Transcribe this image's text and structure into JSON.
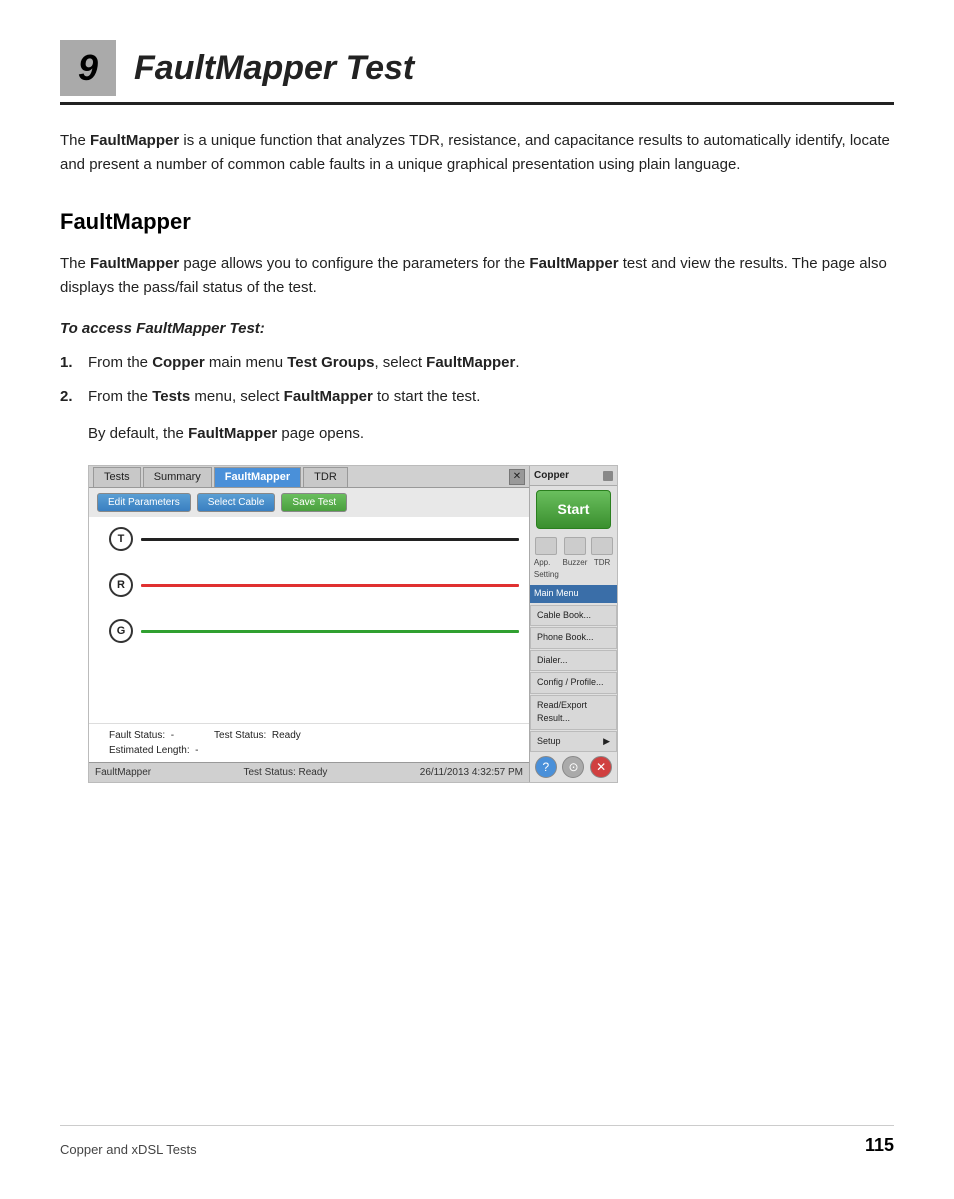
{
  "chapter": {
    "number": "9",
    "title": "FaultMapper Test"
  },
  "intro": {
    "text_prefix": "The ",
    "bold1": "FaultMapper",
    "text_middle": " is a unique function that analyzes TDR, resistance, and capacitance results to automatically identify, locate and present a number of common cable faults in a unique graphical presentation using plain language."
  },
  "section": {
    "title": "FaultMapper",
    "para_prefix": "The ",
    "para_bold1": "FaultMapper",
    "para_text1": " page allows you to configure the parameters for the ",
    "para_bold2": "FaultMapper",
    "para_text2": " test and view the results. The page also displays the pass/fail status of the test."
  },
  "access": {
    "heading": "To access FaultMapper Test:",
    "steps": [
      {
        "num": "1.",
        "text_prefix": "From the ",
        "bold1": "Copper",
        "text_middle": " main menu ",
        "bold2": "Test Groups",
        "text_end": ", select ",
        "bold3": "FaultMapper",
        "text_final": "."
      },
      {
        "num": "2.",
        "text_prefix": "From the ",
        "bold1": "Tests",
        "text_middle": " menu, select ",
        "bold2": "FaultMapper",
        "text_end": " to start the test."
      }
    ],
    "bydefault_prefix": "By default, the ",
    "bydefault_bold": "FaultMapper",
    "bydefault_suffix": " page opens."
  },
  "screenshot": {
    "tabs": [
      "Tests",
      "Summary",
      "FaultMapper",
      "TDR"
    ],
    "active_tab": "FaultMapper",
    "buttons": {
      "edit": "Edit Parameters",
      "select": "Select Cable",
      "save": "Save Test"
    },
    "wires": [
      {
        "label": "T",
        "color": "black"
      },
      {
        "label": "R",
        "color": "red"
      },
      {
        "label": "G",
        "color": "green"
      }
    ],
    "fault_status_label": "Fault Status:",
    "fault_status_value": "-",
    "test_status_label": "Test Status:",
    "test_status_value": "Ready",
    "estimated_length_label": "Estimated Length:",
    "estimated_length_value": "-",
    "statusbar_left": "FaultMapper",
    "statusbar_center": "Test Status: Ready",
    "statusbar_right": "26/11/2013  4:32:57 PM"
  },
  "sidebar": {
    "title": "Copper",
    "start_button": "Start",
    "icon_labels": [
      "App. Setting",
      "Buzzer",
      "TDR"
    ],
    "main_menu": "Main Menu",
    "menu_items": [
      "Cable Book...",
      "Phone Book...",
      "Dialer...",
      "Config / Profile...",
      "Read/Export Result...",
      "Setup"
    ],
    "setup_arrow": "▶"
  },
  "footer": {
    "left": "Copper and xDSL Tests",
    "right": "115"
  }
}
